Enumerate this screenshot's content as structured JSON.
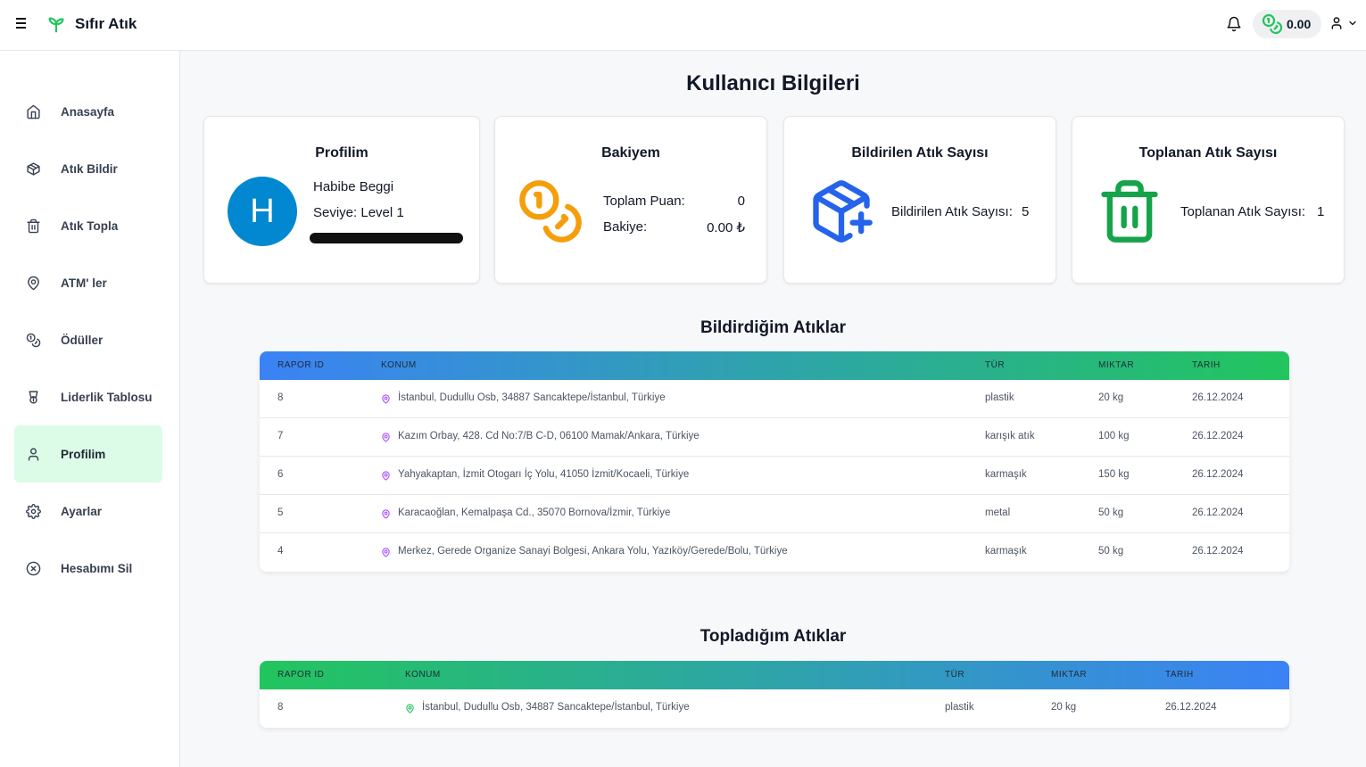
{
  "app": {
    "title": "Sıfır Atık",
    "balance": "0.00"
  },
  "colors": {
    "brand_green": "#22c55e",
    "avatar_blue": "#0288d1",
    "coin_orange": "#f59e0b",
    "box_blue": "#2563eb",
    "bin_green": "#16a34a"
  },
  "sidebar": {
    "items": [
      {
        "label": "Anasayfa",
        "icon": "home-icon"
      },
      {
        "label": "Atık Bildir",
        "icon": "package-icon"
      },
      {
        "label": "Atık Topla",
        "icon": "trash-icon"
      },
      {
        "label": "ATM' ler",
        "icon": "map-pin-icon"
      },
      {
        "label": "Ödüller",
        "icon": "coins-icon"
      },
      {
        "label": "Liderlik Tablosu",
        "icon": "trophy-icon"
      },
      {
        "label": "Profilim",
        "icon": "user-icon"
      },
      {
        "label": "Ayarlar",
        "icon": "gear-icon"
      },
      {
        "label": "Hesabımı Sil",
        "icon": "circle-x-icon"
      }
    ]
  },
  "main": {
    "title": "Kullanıcı Bilgileri",
    "profile": {
      "title": "Profilim",
      "initial": "H",
      "name": "Habibe Beggi",
      "level": "Seviye: Level 1"
    },
    "wallet": {
      "title": "Bakiyem",
      "points_label": "Toplam Puan:",
      "points_value": "0",
      "balance_label": "Bakiye:",
      "balance_value": "0.00 ₺"
    },
    "reported": {
      "title": "Bildirilen Atık Sayısı",
      "label": "Bildirilen Atık Sayısı:",
      "value": "5"
    },
    "collected": {
      "title": "Toplanan Atık Sayısı",
      "label": "Toplanan Atık Sayısı:",
      "value": "1"
    }
  },
  "reported_table": {
    "title": "Bildirdiğim Atıklar",
    "headers": [
      "RAPOR ID",
      "KONUM",
      "TÜR",
      "MIKTAR",
      "TARIH"
    ],
    "rows": [
      [
        "8",
        "İstanbul, Dudullu Osb, 34887 Sancaktepe/İstanbul, Türkiye",
        "plastik",
        "20 kg",
        "26.12.2024"
      ],
      [
        "7",
        "Kazım Orbay, 428. Cd No:7/B C-D, 06100 Mamak/Ankara, Türkiye",
        "karışık atık",
        "100 kg",
        "26.12.2024"
      ],
      [
        "6",
        "Yahyakaptan, İzmit Otogarı İç Yolu, 41050 İzmit/Kocaeli, Türkiye",
        "karmaşık",
        "150 kg",
        "26.12.2024"
      ],
      [
        "5",
        "Karacaoğlan, Kemalpaşa Cd., 35070 Bornova/İzmir, Türkiye",
        "metal",
        "50 kg",
        "26.12.2024"
      ],
      [
        "4",
        "Merkez, Gerede Organize Sanayi Bolgesi, Ankara Yolu, Yazıköy/Gerede/Bolu, Türkiye",
        "karmaşık",
        "50 kg",
        "26.12.2024"
      ]
    ]
  },
  "collected_table": {
    "title": "Topladığım Atıklar",
    "headers": [
      "RAPOR ID",
      "KONUM",
      "TÜR",
      "MIKTAR",
      "TARIH"
    ],
    "rows": [
      [
        "8",
        "İstanbul, Dudullu Osb, 34887 Sancaktepe/İstanbul, Türkiye",
        "plastik",
        "20 kg",
        "26.12.2024"
      ]
    ]
  }
}
